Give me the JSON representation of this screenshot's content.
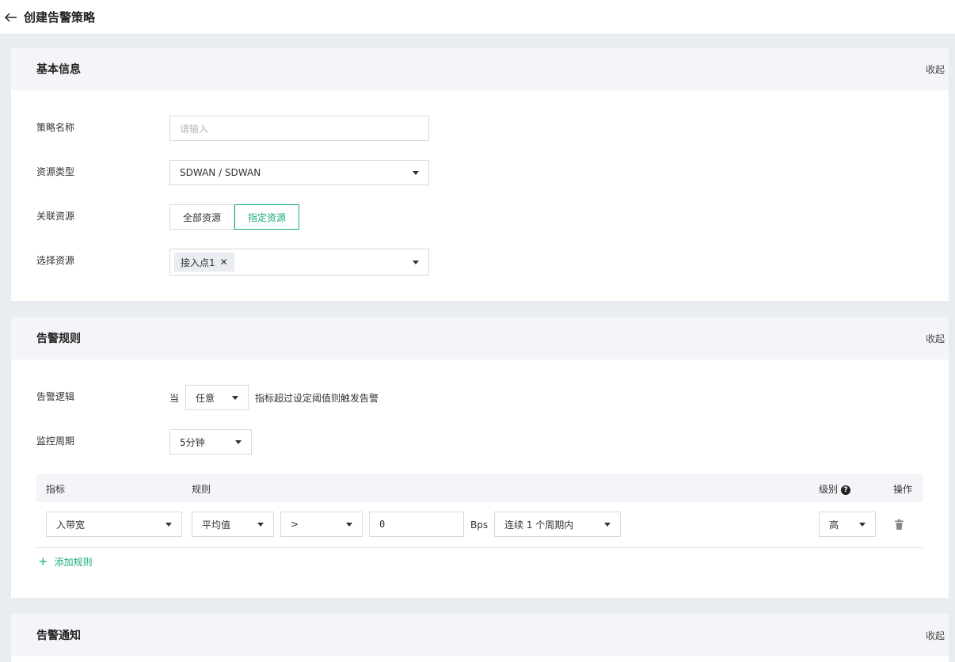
{
  "header": {
    "title": "创建告警策略"
  },
  "basic": {
    "title": "基本信息",
    "collapse": "收起",
    "name_label": "策略名称",
    "name_placeholder": "请输入",
    "type_label": "资源类型",
    "type_value": "SDWAN / SDWAN",
    "assoc_label": "关联资源",
    "assoc_options": [
      "全部资源",
      "指定资源"
    ],
    "assoc_selected": "指定资源",
    "select_label": "选择资源",
    "selected_tags": [
      "接入点1"
    ]
  },
  "rules": {
    "title": "告警规则",
    "collapse": "收起",
    "logic_label": "告警逻辑",
    "logic_prefix": "当",
    "logic_value": "任意",
    "logic_suffix": "指标超过设定阈值则触发告警",
    "period_label": "监控周期",
    "period_value": "5分钟",
    "columns": {
      "metric": "指标",
      "rule": "规则",
      "level": "级别",
      "action": "操作"
    },
    "row": {
      "metric": "入带宽",
      "agg": "平均值",
      "op": ">",
      "threshold": "0",
      "unit": "Bps",
      "duration": "连续 1 个周期内",
      "level": "高"
    },
    "add_rule": "添加规则"
  },
  "notify": {
    "title": "告警通知",
    "collapse": "收起"
  },
  "colors": {
    "accent": "#1aab7c"
  }
}
